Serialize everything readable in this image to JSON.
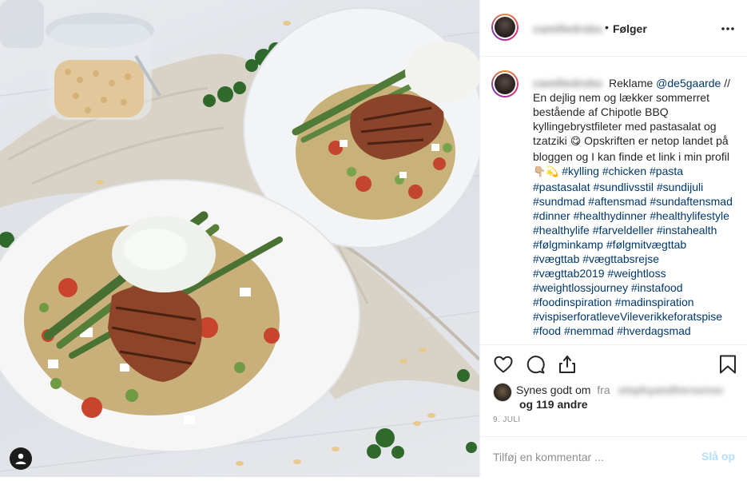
{
  "post": {
    "username": "camilledrobo",
    "separator": "•",
    "follow_label": "Følger",
    "more_icon": "more-icon"
  },
  "caption": {
    "username": "camilledrobo",
    "intro": "Reklame",
    "mention": "@de5gaarde",
    "after_mention": " // En dejlig nem og lækker sommerret bestående af Chipotle BBQ kyllingebrystfileter med pastasalat og tzatziki ",
    "emoji1": "😋",
    "middle": " Opskriften er netop landet på bloggen og I kan finde et link i min profil ",
    "emoji2": "👇🏼💫",
    "hashtags": [
      "#kylling",
      "#chicken",
      "#pasta",
      "#pastasalat",
      "#sundlivsstil",
      "#sundijuli",
      "#sundmad",
      "#aftensmad",
      "#sundaftensmad",
      "#dinner",
      "#healthydinner",
      "#healthylifestyle",
      "#healthylife",
      "#farveldeller",
      "#instahealth",
      "#følgminkamp",
      "#følgmitvægttab",
      "#vægttab",
      "#vægttabsrejse",
      "#vægttab2019",
      "#weightloss",
      "#weightlossjourney",
      "#instafood",
      "#foodinspiration",
      "#madinspiration",
      "#vispiserforatleveVileverikkeforatspise",
      "#food",
      "#nemmad",
      "#hverdagsmad"
    ]
  },
  "actions": {
    "like_icon": "heart-icon",
    "comment_icon": "comment-icon",
    "share_icon": "share-icon",
    "save_icon": "bookmark-icon"
  },
  "likes": {
    "prefix": "Synes godt om",
    "fra": "fra",
    "liker": "stephyandhersense",
    "others": "og 119 andre"
  },
  "date": "9. JULI",
  "comment": {
    "placeholder": "Tilføj en kommentar ...",
    "post_label": "Slå op"
  },
  "colors": {
    "link": "#00376b",
    "muted": "#8e8e8e",
    "post_button": "#b2dffc"
  }
}
